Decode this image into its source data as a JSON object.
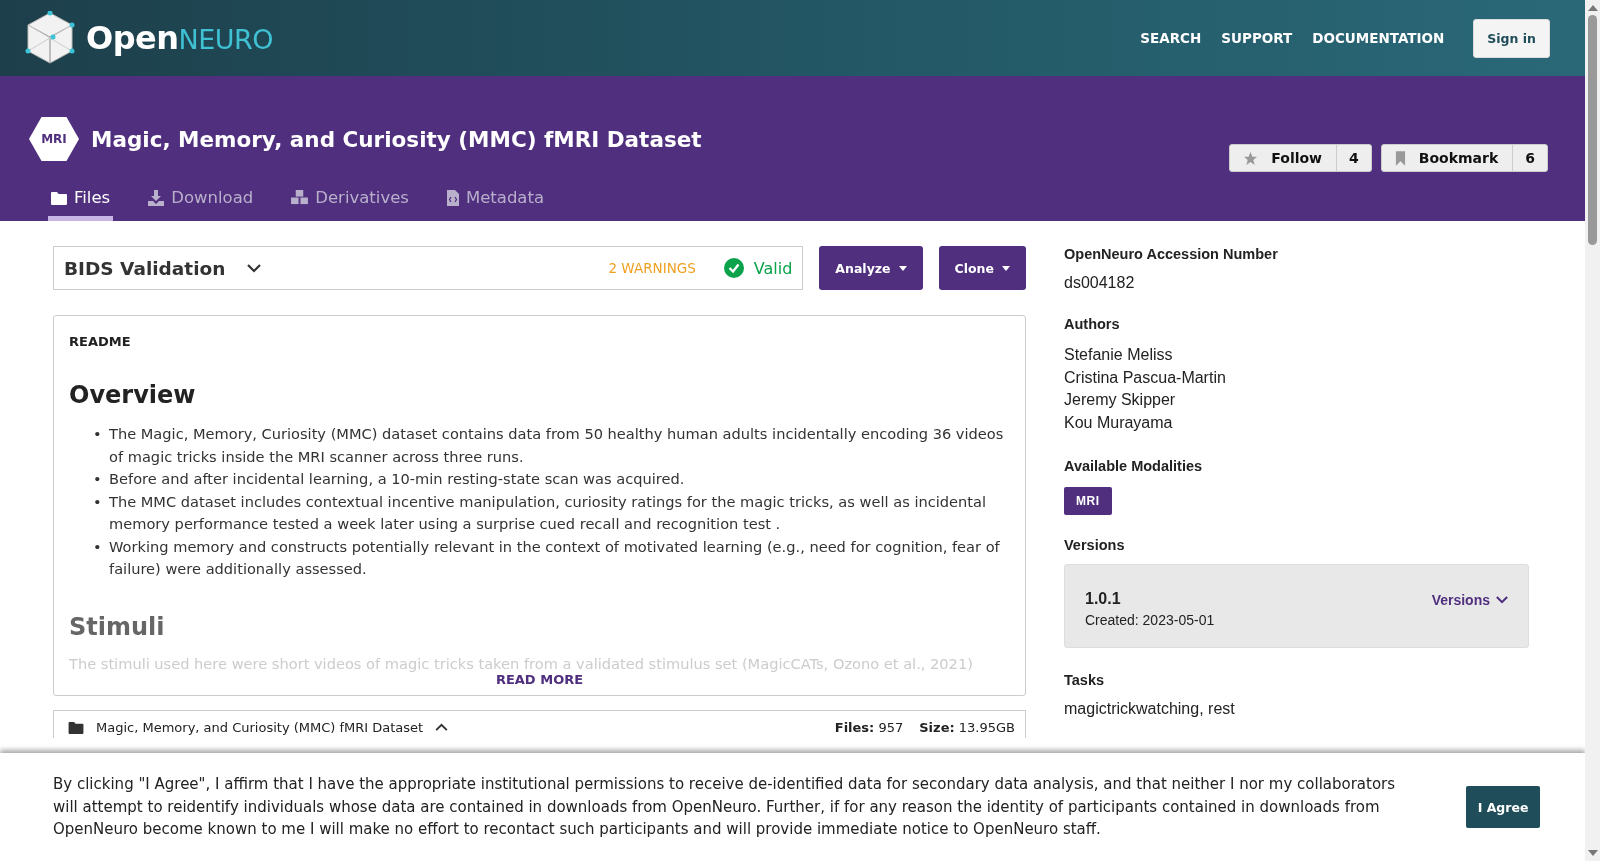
{
  "header": {
    "logo": {
      "open": "Open",
      "neuro": "NEURO"
    },
    "nav": [
      "SEARCH",
      "SUPPORT",
      "DOCUMENTATION"
    ],
    "sign_in": "Sign in"
  },
  "dataset": {
    "badge": "MRI",
    "title": "Magic, Memory, and Curiosity (MMC) fMRI Dataset",
    "follow": {
      "label": "Follow",
      "count": "4"
    },
    "bookmark": {
      "label": "Bookmark",
      "count": "6"
    }
  },
  "tabs": [
    {
      "label": "Files",
      "kind": "folder",
      "selected": true
    },
    {
      "label": "Download",
      "kind": "download",
      "selected": false
    },
    {
      "label": "Derivatives",
      "kind": "cubes",
      "selected": false
    },
    {
      "label": "Metadata",
      "kind": "file",
      "selected": false
    }
  ],
  "validation": {
    "title": "BIDS Validation",
    "warnings": "2 WARNINGS",
    "status": "Valid"
  },
  "actions": [
    "Analyze",
    "Clone"
  ],
  "readme": {
    "label": "README",
    "marker": "•",
    "heading": "Overview",
    "bullets": [
      "The Magic, Memory, Curiosity (MMC) dataset contains data from 50 healthy human adults incidentally encoding 36 videos of magic tricks inside the MRI scanner across three runs.",
      "Before and after incidental learning, a 10-min resting-state scan was acquired.",
      "The MMC dataset includes contextual incentive manipulation, curiosity ratings for the magic tricks, as well as incidental memory performance tested a week later using a surprise cued recall and recognition test .",
      "Working memory and constructs potentially relevant in the context of motivated learning (e.g., need for cognition, fear of failure) were additionally assessed."
    ],
    "subheading": "Stimuli",
    "faded_text": "The stimuli used here were short videos of magic tricks taken from a validated stimulus set (MagicCATs, Ozono et al., 2021)",
    "read_more": "READ MORE"
  },
  "files": {
    "name": "Magic, Memory, and Curiosity (MMC) fMRI Dataset",
    "expanded": true,
    "files_label": "Files:",
    "files_value": "957",
    "size_label": "Size:",
    "size_value": "13.95GB"
  },
  "sidebar": {
    "accession": {
      "label": "OpenNeuro Accession Number",
      "value": "ds004182"
    },
    "authors": {
      "label": "Authors",
      "names": [
        "Stefanie Meliss",
        "Cristina Pascua-Martin",
        "Jeremy Skipper",
        "Kou Murayama"
      ]
    },
    "modalities": {
      "label": "Available Modalities",
      "items": [
        "MRI"
      ]
    },
    "versions": {
      "label": "Versions",
      "current": "1.0.1",
      "created": "Created: 2023-05-01",
      "menu": "Versions"
    },
    "tasks": {
      "label": "Tasks",
      "value": "magictrickwatching, rest"
    }
  },
  "consent": {
    "text": "By clicking \"I Agree\", I affirm that I have the appropriate institutional permissions to receive de-identified data for secondary data analysis, and that neither I nor my collaborators will attempt to reidentify individuals whose data are contained in downloads from OpenNeuro. Further, if for any reason the identity of participants contained in downloads from OpenNeuro become known to me I will make no effort to recontact such participants and will provide immediate notice to OpenNeuro staff.",
    "button": "I Agree"
  }
}
